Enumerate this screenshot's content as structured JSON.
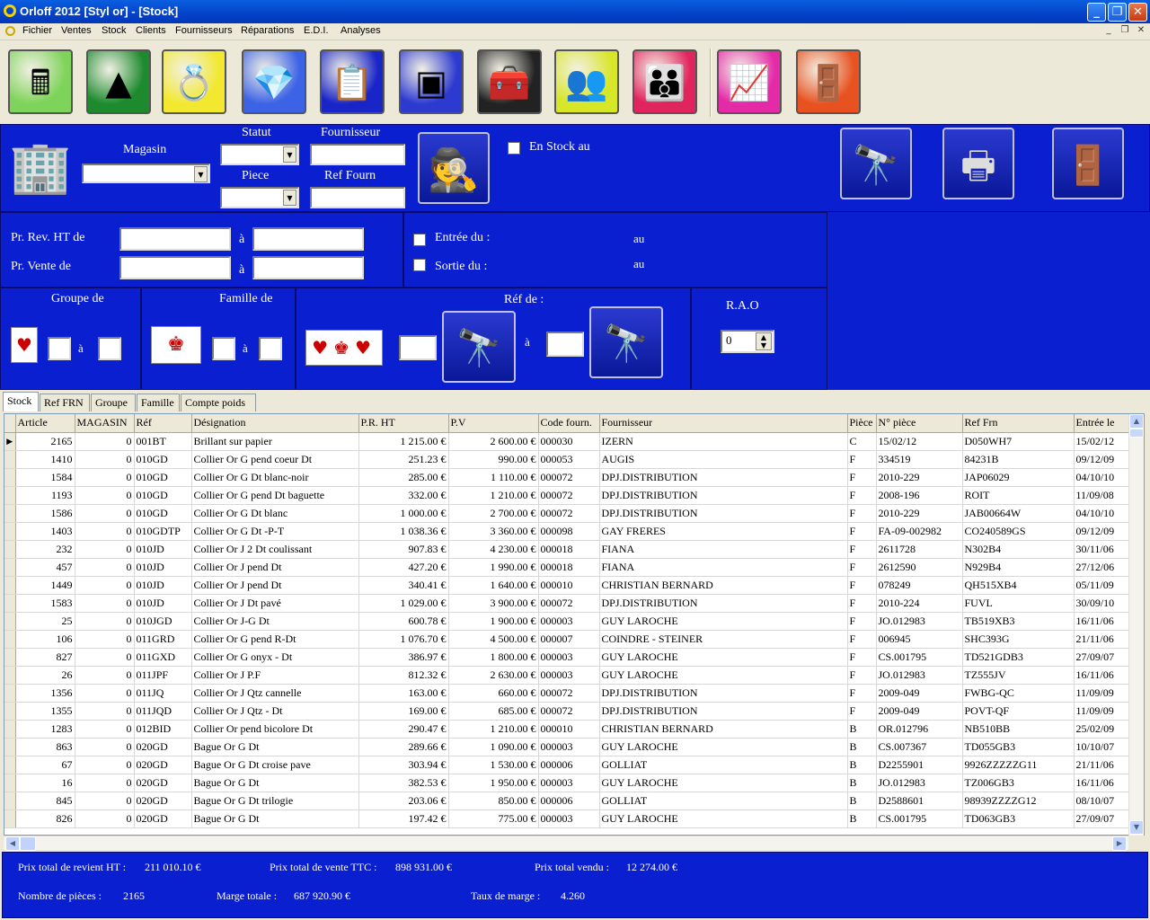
{
  "window": {
    "title": "Orloff 2012 [Styl or] - [Stock]",
    "minimize": "_",
    "restore": "❐",
    "close": "✕"
  },
  "menu": {
    "items": [
      "Fichier",
      "Ventes",
      "Stock",
      "Clients",
      "Fournisseurs",
      "Réparations",
      "E.D.I.",
      "Analyses"
    ],
    "mdi_minimize": "_",
    "mdi_restore": "❐",
    "mdi_close": "✕"
  },
  "toolbar": [
    {
      "icon": "cash-register-icon",
      "glyph": "🖩",
      "color": "#7ed35a"
    },
    {
      "icon": "pyramid-icon",
      "glyph": "▲",
      "color": "#1d8a2e"
    },
    {
      "icon": "jewelry-icon",
      "glyph": "💍",
      "color": "#f2e830"
    },
    {
      "icon": "diamond-icon",
      "glyph": "💎",
      "color": "#3c62e6"
    },
    {
      "icon": "clipboard-icon",
      "glyph": "📋",
      "color": "#1a25c8"
    },
    {
      "icon": "safe-icon",
      "glyph": "▣",
      "color": "#2d3ad0"
    },
    {
      "icon": "toolbox-icon",
      "glyph": "🧰",
      "color": "#222222"
    },
    {
      "icon": "suppliers-icon",
      "glyph": "👥",
      "color": "#d8e628"
    },
    {
      "icon": "clients-icon",
      "glyph": "👪",
      "color": "#e0245e"
    },
    {
      "icon": "analysis-icon",
      "glyph": "📈",
      "color": "#e52aa8"
    },
    {
      "icon": "exit-door-icon",
      "glyph": "🚪",
      "color": "#e85220"
    }
  ],
  "filters": {
    "magasin_label": "Magasin",
    "magasin_value": "",
    "statut_label": "Statut",
    "statut_value": "",
    "piece_label": "Piece",
    "piece_value": "",
    "fournisseur_label": "Fournisseur",
    "fournisseur_value": "",
    "ref_fourn_label": "Ref Fourn",
    "ref_fourn_value": "",
    "en_stock_label": "En Stock au",
    "pr_rev_label": "Pr. Rev. HT de",
    "pr_vente_label": "Pr. Vente de",
    "a": "à",
    "entree_label": "Entrée du :",
    "sortie_label": "Sortie du :",
    "au": "au",
    "groupe_label": "Groupe de",
    "famille_label": "Famille de",
    "ref_label": "Réf de :",
    "rao_label": "R.A.O",
    "rao_value": "0"
  },
  "tabs": [
    "Stock",
    "Ref FRN",
    "Groupe",
    "Famille",
    "Compte poids"
  ],
  "table": {
    "columns": [
      "Article",
      "MAGASIN",
      "Réf",
      "Désignation",
      "P.R. HT",
      "P.V",
      "Code fourn.",
      "Fournisseur",
      "Pièce",
      "N° pièce",
      "Ref Frn",
      "Entrée le"
    ],
    "rows": [
      [
        "2165",
        "0",
        "001BT",
        "Brillant sur papier",
        "1 215.00 €",
        "2 600.00 €",
        "000030",
        "IZERN",
        "C",
        "15/02/12",
        "D050WH7",
        "15/02/12"
      ],
      [
        "1410",
        "0",
        "010GD",
        "Collier Or G  pend coeur Dt",
        "251.23 €",
        "990.00 €",
        "000053",
        "AUGIS",
        "F",
        "334519",
        "84231B",
        "09/12/09"
      ],
      [
        "1584",
        "0",
        "010GD",
        "Collier Or G  Dt  blanc-noir",
        "285.00 €",
        "1 110.00 €",
        "000072",
        "DPJ.DISTRIBUTION",
        "F",
        "2010-229",
        "JAP06029",
        "04/10/10"
      ],
      [
        "1193",
        "0",
        "010GD",
        "Collier Or G pend Dt baguette",
        "332.00 €",
        "1 210.00 €",
        "000072",
        "DPJ.DISTRIBUTION",
        "F",
        "2008-196",
        "ROIT",
        "11/09/08"
      ],
      [
        "1586",
        "0",
        "010GD",
        "Collier Or G  Dt  blanc",
        "1 000.00 €",
        "2 700.00 €",
        "000072",
        "DPJ.DISTRIBUTION",
        "F",
        "2010-229",
        "JAB00664W",
        "04/10/10"
      ],
      [
        "1403",
        "0",
        "010GDTP",
        "Collier Or G  Dt -P-T",
        "1 038.36 €",
        "3 360.00 €",
        "000098",
        "GAY  FRERES",
        "F",
        "FA-09-002982",
        "CO240589GS",
        "09/12/09"
      ],
      [
        "232",
        "0",
        "010JD",
        "Collier Or J  2 Dt coulissant",
        "907.83 €",
        "4 230.00 €",
        "000018",
        "FIANA",
        "F",
        "2611728",
        "N302B4",
        "30/11/06"
      ],
      [
        "457",
        "0",
        "010JD",
        "Collier Or J pend Dt",
        "427.20 €",
        "1 990.00 €",
        "000018",
        "FIANA",
        "F",
        "2612590",
        "N929B4",
        "27/12/06"
      ],
      [
        "1449",
        "0",
        "010JD",
        "Collier Or J    pend Dt",
        "340.41 €",
        "1 640.00 €",
        "000010",
        "CHRISTIAN BERNARD",
        "F",
        "078249",
        "QH515XB4",
        "05/11/09"
      ],
      [
        "1583",
        "0",
        "010JD",
        "Collier Or J  Dt pavé",
        "1 029.00 €",
        "3 900.00 €",
        "000072",
        "DPJ.DISTRIBUTION",
        "F",
        "2010-224",
        "FUVL",
        "30/09/10"
      ],
      [
        "25",
        "0",
        "010JGD",
        "Collier Or J-G  Dt",
        "600.78 €",
        "1 900.00 €",
        "000003",
        "GUY  LAROCHE",
        "F",
        "JO.012983",
        "TB519XB3",
        "16/11/06"
      ],
      [
        "106",
        "0",
        "011GRD",
        "Collier Or G  pend R-Dt",
        "1 076.70 €",
        "4 500.00 €",
        "000007",
        "COINDRE - STEINER",
        "F",
        "006945",
        "SHC393G",
        "21/11/06"
      ],
      [
        "827",
        "0",
        "011GXD",
        "Collier Or G  onyx - Dt",
        "386.97 €",
        "1 800.00 €",
        "000003",
        "GUY  LAROCHE",
        "F",
        "CS.001795",
        "TD521GDB3",
        "27/09/07"
      ],
      [
        "26",
        "0",
        "011JPF",
        "Collier Or J  P.F",
        "812.32 €",
        "2 630.00 €",
        "000003",
        "GUY  LAROCHE",
        "F",
        "JO.012983",
        "TZ555JV",
        "16/11/06"
      ],
      [
        "1356",
        "0",
        "011JQ",
        "Collier Or J Qtz cannelle",
        "163.00 €",
        "660.00 €",
        "000072",
        "DPJ.DISTRIBUTION",
        "F",
        "2009-049",
        "FWBG-QC",
        "11/09/09"
      ],
      [
        "1355",
        "0",
        "011JQD",
        "Collier Or J Qtz - Dt",
        "169.00 €",
        "685.00 €",
        "000072",
        "DPJ.DISTRIBUTION",
        "F",
        "2009-049",
        "POVT-QF",
        "11/09/09"
      ],
      [
        "1283",
        "0",
        "012BID",
        "Collier Or pend bicolore  Dt",
        "290.47 €",
        "1 210.00 €",
        "000010",
        "CHRISTIAN BERNARD",
        "B",
        "OR.012796",
        "NB510BB",
        "25/02/09"
      ],
      [
        "863",
        "0",
        "020GD",
        "Bague Or G  Dt",
        "289.66 €",
        "1 090.00 €",
        "000003",
        "GUY  LAROCHE",
        "B",
        "CS.007367",
        "TD055GB3",
        "10/10/07"
      ],
      [
        "67",
        "0",
        "020GD",
        "Bague Or G  Dt  croise pave",
        "303.94 €",
        "1 530.00 €",
        "000006",
        "GOLLIAT",
        "B",
        "D2255901",
        "9926ZZZZZG11",
        "21/11/06"
      ],
      [
        "16",
        "0",
        "020GD",
        "Bague Or G   Dt",
        "382.53 €",
        "1 950.00 €",
        "000003",
        "GUY  LAROCHE",
        "B",
        "JO.012983",
        "TZ006GB3",
        "16/11/06"
      ],
      [
        "845",
        "0",
        "020GD",
        "Bague Or G  Dt trilogie",
        "203.06 €",
        "850.00 €",
        "000006",
        "GOLLIAT",
        "B",
        "D2588601",
        "98939ZZZZG12",
        "08/10/07"
      ],
      [
        "826",
        "0",
        "020GD",
        "Bague Or G  Dt",
        "197.42 €",
        "775.00 €",
        "000003",
        "GUY  LAROCHE",
        "B",
        "CS.001795",
        "TD063GB3",
        "27/09/07"
      ]
    ]
  },
  "totals": {
    "prix_revient_label": "Prix total de revient HT :",
    "prix_revient_value": "211 010.10 €",
    "prix_vente_label": "Prix total de vente TTC :",
    "prix_vente_value": "898 931.00 €",
    "prix_vendu_label": "Prix total vendu :",
    "prix_vendu_value": "12 274.00 €",
    "nb_pieces_label": "Nombre de pièces :",
    "nb_pieces_value": "2165",
    "marge_label": "Marge totale :",
    "marge_value": "687 920.90 €",
    "taux_label": "Taux de marge :",
    "taux_value": "4.260"
  }
}
